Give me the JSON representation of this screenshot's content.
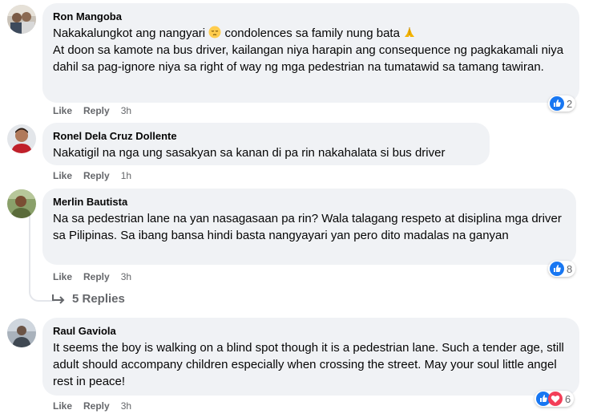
{
  "comments": [
    {
      "author": "Ron Mangoba",
      "text_line1_before": "Nakakalungkot ang nangyari ",
      "text_line1_mid": " condolences sa family nung bata ",
      "text_rest": "At doon sa kamote na bus driver, kailangan niya harapin ang consequence ng pagkakamali niya dahil sa pag-ignore niya sa right of way ng mga pedestrian na tumatawid sa tamang tawiran.",
      "emoji_1": "pensive-face-emoji",
      "emoji_2": "folded-hands-emoji",
      "like_label": "Like",
      "reply_label": "Reply",
      "time": "3h",
      "reaction_count": "2"
    },
    {
      "author": "Ronel Dela Cruz Dollente",
      "text": "Nakatigil na nga ung sasakyan sa kanan di pa rin nakahalata si bus driver",
      "like_label": "Like",
      "reply_label": "Reply",
      "time": "1h"
    },
    {
      "author": "Merlin Bautista",
      "text": "Na sa pedestrian lane na yan nasagasaan pa rin? Wala talagang respeto at disiplina mga driver sa Pilipinas. Sa ibang bansa hindi basta nangyayari yan pero dito madalas na ganyan",
      "like_label": "Like",
      "reply_label": "Reply",
      "time": "3h",
      "reaction_count": "8",
      "replies_label": "5 Replies"
    },
    {
      "author": "Raul Gaviola",
      "text": "It seems the boy is walking on a blind spot though it is a pedestrian lane. Such a tender age, still adult should accompany children especially when crossing the street. May your soul little angel rest in peace!",
      "like_label": "Like",
      "reply_label": "Reply",
      "time": "3h",
      "reaction_count": "6"
    }
  ],
  "colors": {
    "bubble": "#f0f2f5",
    "like_blue": "#1877f2",
    "love_red": "#f33e58",
    "meta_gray": "#65676b"
  }
}
